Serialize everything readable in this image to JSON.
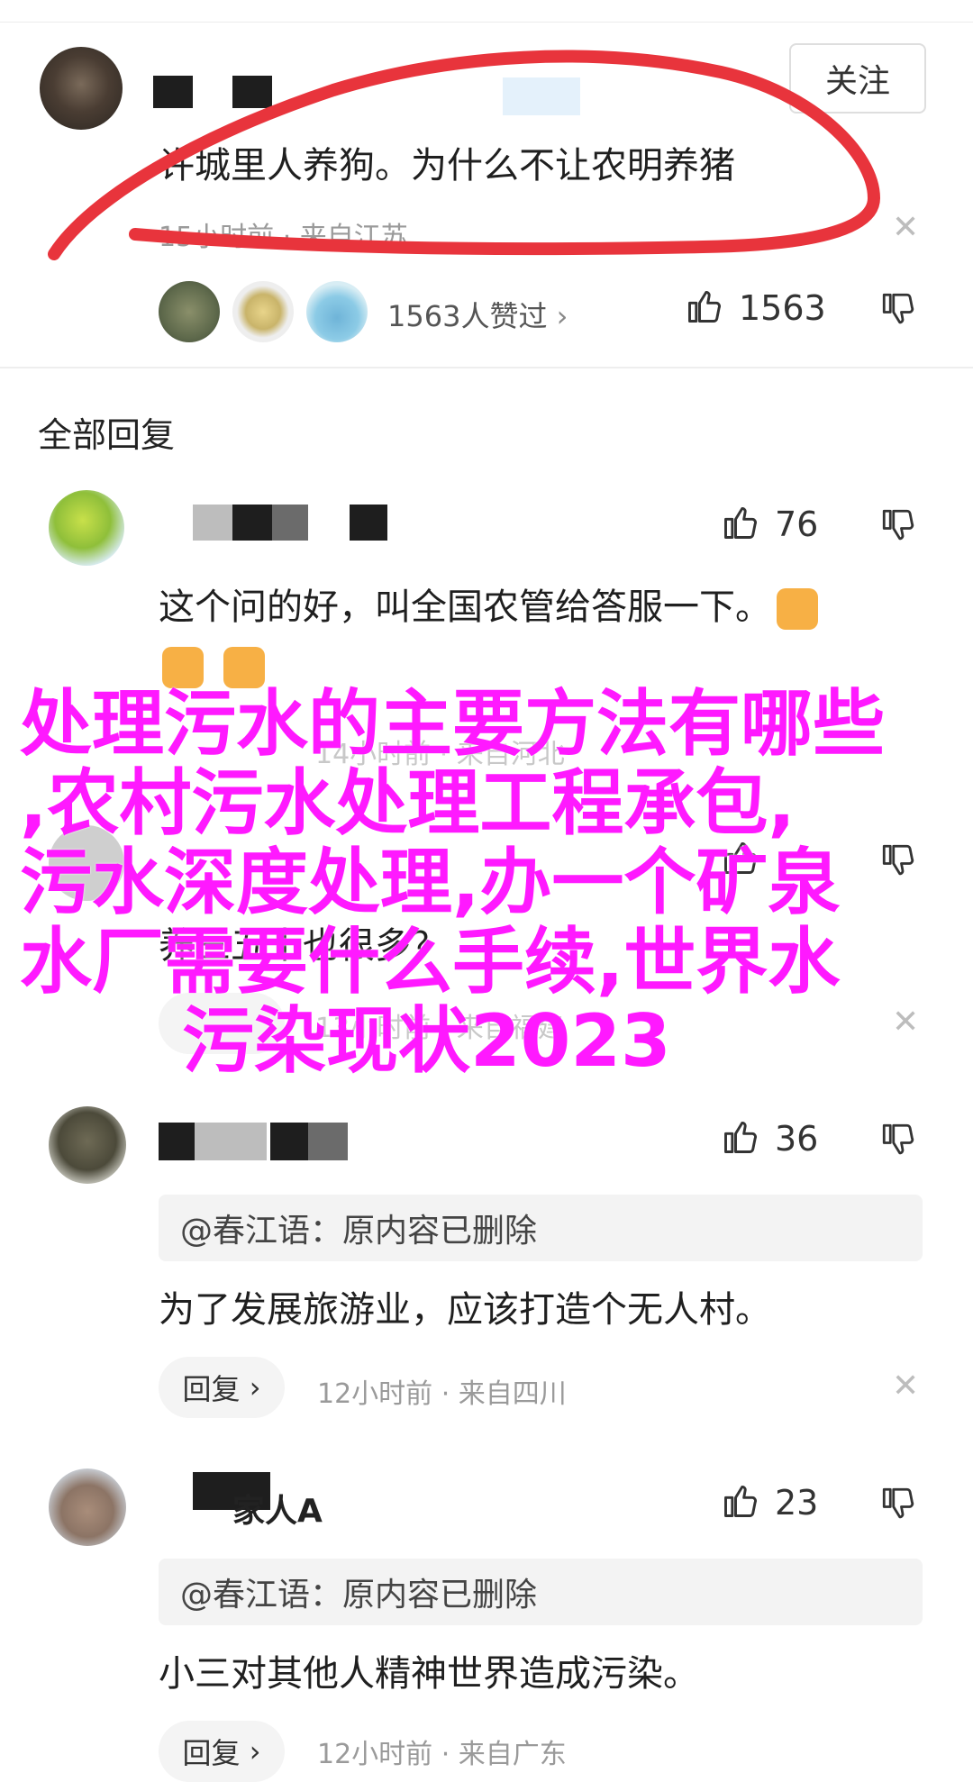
{
  "top_comment": {
    "follow_label": "关注",
    "text": "许城里人养狗。为什么不让农明养猪",
    "meta": "15小时前 · 来自江苏",
    "likes_summary": "1563人赞过",
    "like_count": "1563",
    "annotation_color": "#e8343c"
  },
  "section_title": "全部回复",
  "replies": [
    {
      "like_count": "76",
      "text_line1": "这个问的好，叫全国农管给答服一下。",
      "meta": "14小时前 · 来自河北"
    },
    {
      "text": "养三五十也很多？",
      "meta": "13小时前 · 来自福建"
    },
    {
      "like_count": "36",
      "quote": "@春江语：原内容已删除",
      "text": "为了发展旅游业，应该打造个无人村。",
      "reply_label": "回复",
      "meta": "12小时前 · 来自四川"
    },
    {
      "name_visible": "家人A",
      "like_count": "23",
      "quote": "@春江语：原内容已删除",
      "text": "小三对其他人精神世界造成污染。",
      "reply_label": "回复",
      "meta": "12小时前 · 来自广东"
    }
  ],
  "overlay": {
    "lines": [
      "处理污水的主要方法有哪些",
      ",农村污水处理工程承包,",
      "污水深度处理,办一个矿泉",
      "水厂需要什么手续,世界水",
      "污染现状2023"
    ],
    "color": "#ff19ff"
  },
  "icons": {
    "thumbs_up": "thumbs-up-icon",
    "thumbs_down": "thumbs-down-icon",
    "close": "close-icon",
    "chevron": "chevron-right-icon",
    "emoji": "thumbs-up-emoji"
  }
}
